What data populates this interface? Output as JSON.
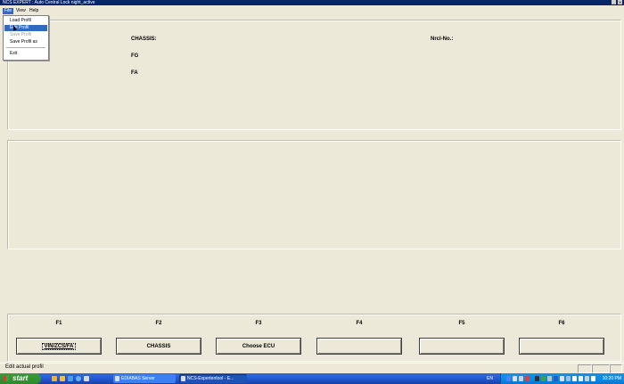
{
  "window": {
    "title": "NCS EXPERT : Auto Central Lock  night_active",
    "controls": [
      "_",
      "✕"
    ]
  },
  "menubar": {
    "items": [
      "File",
      "View",
      "Help"
    ]
  },
  "file_menu": {
    "items": [
      "Load Profil",
      "Edit Profil",
      "Save Profil",
      "Save Profil as",
      "Exit"
    ]
  },
  "info": {
    "chassis_label": "CHASSIS:",
    "fg_label": "FG",
    "fa_label": "FA",
    "ncsl_label": "Nrcl-No.:"
  },
  "function_keys": {
    "labels": [
      "F1",
      "F2",
      "F3",
      "F4",
      "F5",
      "F6"
    ],
    "buttons": [
      "VIN/ZCS/FA",
      "CHASSIS",
      "Choose ECU",
      "",
      "",
      ""
    ]
  },
  "status": {
    "text": "Edit actual profil"
  },
  "taskbar": {
    "start_label": "start",
    "tasks": [
      "EDIABAS Server",
      "NCS-Expertentool - E..."
    ],
    "lang": "EN",
    "clock": "10:20 PM"
  }
}
